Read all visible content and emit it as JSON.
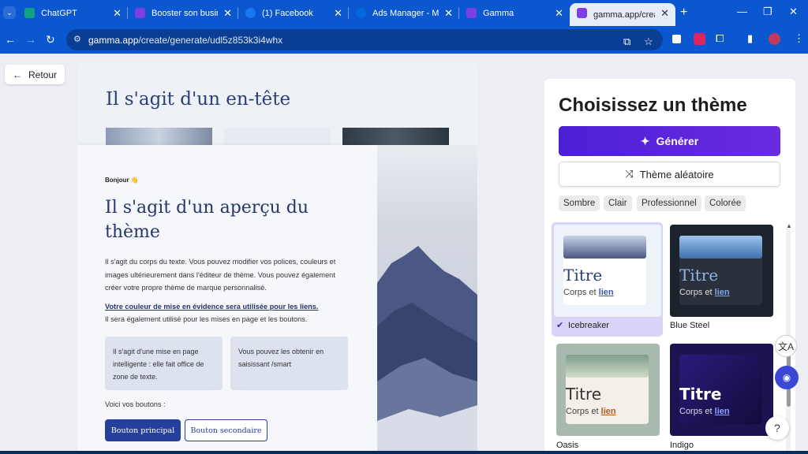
{
  "tabs": [
    {
      "title": "ChatGPT",
      "icon": "chatgpt-icon",
      "color": "#10a37f"
    },
    {
      "title": "Booster son business",
      "icon": "gamma-icon",
      "color": "#7b3fe4"
    },
    {
      "title": "(1) Facebook",
      "icon": "facebook-icon",
      "color": "#1877f2"
    },
    {
      "title": "Ads Manager - Mana",
      "icon": "meta-icon",
      "color": "#0668e1"
    },
    {
      "title": "Gamma",
      "icon": "gamma-icon",
      "color": "#7b3fe4"
    },
    {
      "title": "gamma.app/create/g",
      "icon": "gamma-icon",
      "color": "#7b3fe4"
    }
  ],
  "address": {
    "domain": "gamma.app",
    "path": "/create/generate/udl5z853k3i4whx"
  },
  "back_label": "Retour",
  "preview": {
    "header_title": "Il s'agit d'un en-tête",
    "hello": "Bonjour 👋",
    "heading": "Il s'agit d'un aperçu du thème",
    "body": "Il s'agit du corps du texte. Vous pouvez modifier vos polices, couleurs et images ultérieurement dans l'éditeur de thème. Vous pouvez également créer votre propre thème de marque personnalisé.",
    "link": "Votre couleur de mise en évidence sera utilisée pour les liens.",
    "body2": "Il sera également utilisé pour les mises en page et les boutons.",
    "box1": "Il s'agit d'une mise en page intelligente : elle fait office de zone de texte.",
    "box2": "Vous pouvez les obtenir en saisissant /smart",
    "buttons_label": "Voici vos boutons :",
    "primary": "Bouton principal",
    "secondary": "Bouton secondaire"
  },
  "panel": {
    "title": "Choisissez un thème",
    "generate": "Générer",
    "random": "Thème aléatoire",
    "filters": [
      "Sombre",
      "Clair",
      "Professionnel",
      "Colorée"
    ],
    "themes": [
      {
        "name": "Icebreaker",
        "title": "Titre",
        "body": "Corps et",
        "link": "lien",
        "selected": true
      },
      {
        "name": "Blue Steel",
        "title": "Titre",
        "body": "Corps et",
        "link": "lien",
        "selected": false
      },
      {
        "name": "Oasis",
        "title": "Titre",
        "body": "Corps et",
        "link": "lien",
        "selected": false
      },
      {
        "name": "Indigo",
        "title": "Titre",
        "body": "Corps et",
        "link": "lien",
        "selected": false
      }
    ]
  },
  "help_label": "?",
  "accent": "#5a2be0"
}
